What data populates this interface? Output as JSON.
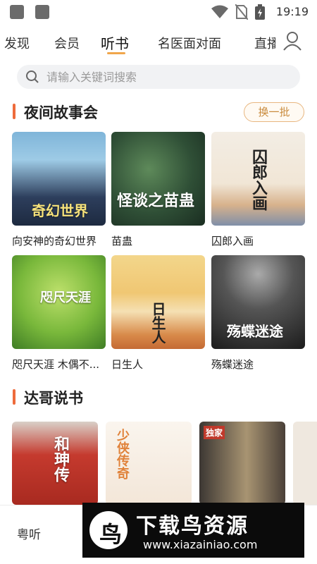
{
  "status_bar": {
    "time": "19:19"
  },
  "nav": {
    "tabs": [
      {
        "label": "发现"
      },
      {
        "label": "会员"
      },
      {
        "label": "听书",
        "active": true
      },
      {
        "label": "名医面对面"
      },
      {
        "label": "直播"
      }
    ]
  },
  "search": {
    "placeholder": "请输入关键词搜索"
  },
  "sections": [
    {
      "title": "夜间故事会",
      "action_label": "换一批",
      "items": [
        {
          "title": "向安神的奇幻世界",
          "cover_text": "奇幻世界"
        },
        {
          "title": "苗蛊",
          "cover_text": "怪谈之苗蛊"
        },
        {
          "title": "囚郎入画",
          "cover_text": "囚郎入画"
        },
        {
          "title": "咫尺天涯 木偶不...",
          "cover_text": "咫尺天涯"
        },
        {
          "title": "日生人",
          "cover_text": "日生人"
        },
        {
          "title": "殇蝶迷途",
          "cover_text": "殇蝶迷途"
        }
      ]
    },
    {
      "title": "达哥说书",
      "items": [
        {
          "cover_text": "和珅传"
        },
        {
          "cover_text": "少侠传奇"
        },
        {
          "cover_text": "独家"
        },
        {
          "cover_text": ""
        }
      ]
    }
  ],
  "bottom_bar": {
    "label": "粤听"
  },
  "watermark": {
    "title": "下载鸟资源",
    "url": "www.xiazainiao.com"
  },
  "colors": {
    "accent": "#ee6b3b",
    "tab_underline": "#f0a64b",
    "refresh_border": "#e8b680"
  },
  "icons": [
    "search-icon",
    "user-icon",
    "wifi-icon",
    "no-sim-icon",
    "battery-icon"
  ]
}
